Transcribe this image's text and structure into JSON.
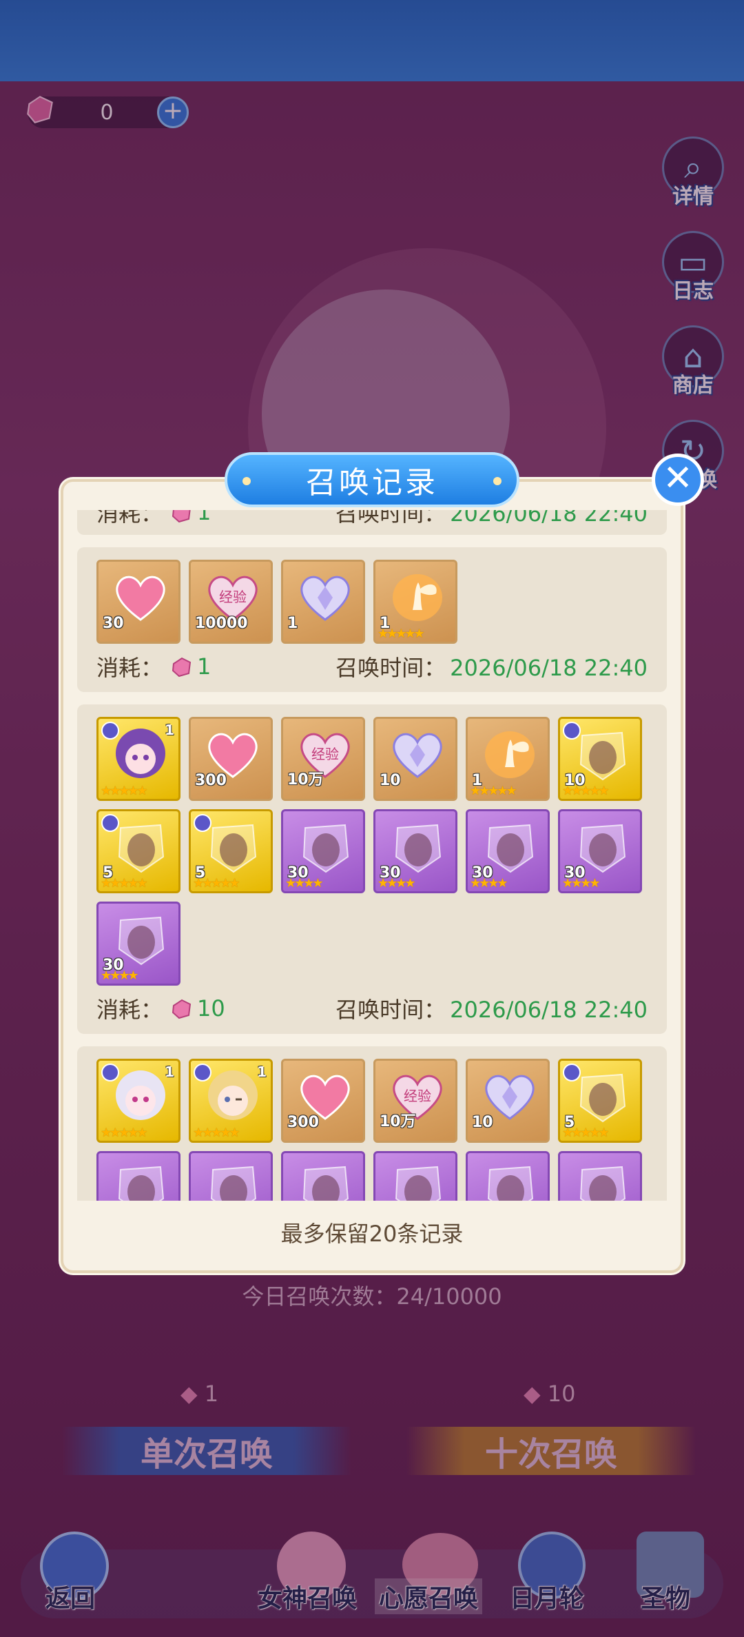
{
  "hud": {
    "currency_value": "0",
    "side_buttons": [
      {
        "label": "详情",
        "icon": "magnifier-icon"
      },
      {
        "label": "日志",
        "icon": "book-icon"
      },
      {
        "label": "商店",
        "icon": "shop-icon"
      },
      {
        "label": "换",
        "icon": "refresh-icon"
      }
    ]
  },
  "modal": {
    "title": "召唤记录",
    "footer": "最多保留20条记录",
    "cost_label": "消耗：",
    "time_label": "召唤时间：",
    "partial_top_record": {
      "cost": "1",
      "time": "2026/06/18 22:40"
    },
    "records": [
      {
        "cost": "1",
        "time": "2026/06/18 22:40",
        "items": [
          {
            "type": "heart",
            "frame": "bronze",
            "qty": "30",
            "stars": 0
          },
          {
            "type": "exp-heart",
            "frame": "bronze",
            "qty": "10000",
            "stars": 0,
            "text": "经验"
          },
          {
            "type": "crystal-heart",
            "frame": "bronze",
            "qty": "1",
            "stars": 0
          },
          {
            "type": "fairy",
            "frame": "bronze",
            "qty": "1",
            "stars": 5
          }
        ]
      },
      {
        "cost": "10",
        "time": "2026/06/18 22:40",
        "items": [
          {
            "type": "girl-purple",
            "frame": "gold",
            "qty": "",
            "corner": "1",
            "stars": 5
          },
          {
            "type": "heart",
            "frame": "bronze",
            "qty": "300",
            "stars": 0
          },
          {
            "type": "exp-heart",
            "frame": "bronze",
            "qty": "10万",
            "stars": 0,
            "text": "经验"
          },
          {
            "type": "crystal-heart",
            "frame": "bronze",
            "qty": "10",
            "stars": 0
          },
          {
            "type": "fairy",
            "frame": "bronze",
            "qty": "1",
            "stars": 5
          },
          {
            "type": "shard",
            "frame": "gold",
            "qty": "10",
            "stars": 5
          },
          {
            "type": "shard",
            "frame": "gold",
            "qty": "5",
            "stars": 5
          },
          {
            "type": "shard",
            "frame": "gold",
            "qty": "5",
            "stars": 5
          },
          {
            "type": "shard",
            "frame": "purple",
            "qty": "30",
            "stars": 4
          },
          {
            "type": "shard",
            "frame": "purple",
            "qty": "30",
            "stars": 4
          },
          {
            "type": "shard",
            "frame": "purple",
            "qty": "30",
            "stars": 4
          },
          {
            "type": "shard",
            "frame": "purple",
            "qty": "30",
            "stars": 4
          },
          {
            "type": "shard",
            "frame": "purple",
            "qty": "30",
            "stars": 4
          }
        ]
      },
      {
        "cost": "",
        "time": "",
        "items": [
          {
            "type": "girl-white",
            "frame": "gold",
            "qty": "",
            "corner": "1",
            "stars": 5
          },
          {
            "type": "girl-blonde",
            "frame": "gold",
            "qty": "",
            "corner": "1",
            "stars": 5
          },
          {
            "type": "heart",
            "frame": "bronze",
            "qty": "300",
            "stars": 0
          },
          {
            "type": "exp-heart",
            "frame": "bronze",
            "qty": "10万",
            "stars": 0,
            "text": "经验"
          },
          {
            "type": "crystal-heart",
            "frame": "bronze",
            "qty": "10",
            "stars": 0
          },
          {
            "type": "shard",
            "frame": "gold",
            "qty": "5",
            "stars": 5
          },
          {
            "type": "shard",
            "frame": "purple",
            "qty": "",
            "stars": 0
          },
          {
            "type": "shard",
            "frame": "purple",
            "qty": "",
            "stars": 0
          },
          {
            "type": "shard",
            "frame": "purple",
            "qty": "",
            "stars": 0
          },
          {
            "type": "shard",
            "frame": "purple",
            "qty": "",
            "stars": 0
          },
          {
            "type": "shard",
            "frame": "purple",
            "qty": "",
            "stars": 0
          },
          {
            "type": "shard",
            "frame": "purple",
            "qty": "",
            "stars": 0
          }
        ]
      }
    ]
  },
  "summon": {
    "daily_count_text": "今日召唤次数：24/10000",
    "single_cost": "1",
    "ten_cost": "10",
    "single_label": "单次召唤",
    "ten_label": "十次召唤"
  },
  "nav": {
    "back": "返回",
    "tabs": [
      "女神召唤",
      "心愿召唤",
      "日月轮",
      "圣物"
    ]
  }
}
